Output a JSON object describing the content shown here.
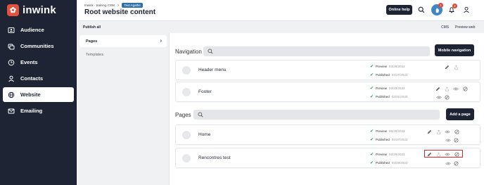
{
  "brand": {
    "name": "inwink"
  },
  "sidebar": {
    "items": [
      {
        "label": "Audience",
        "icon": "id-card-icon"
      },
      {
        "label": "Communities",
        "icon": "communities-icon"
      },
      {
        "label": "Events",
        "icon": "calendar-icon"
      },
      {
        "label": "Contacts",
        "icon": "person-icon"
      },
      {
        "label": "Website",
        "icon": "globe-icon",
        "active": true
      },
      {
        "label": "Emailing",
        "icon": "mail-icon"
      }
    ]
  },
  "header": {
    "breadcrumb": [
      "Inwink - training CSM",
      ">"
    ],
    "env_badge": "Test Agathe",
    "title": "Root website content",
    "online_help": "Online help",
    "notifications": {
      "apps_count": "1",
      "bell_count": "2"
    }
  },
  "subbar": {
    "publish_all": "Publish all",
    "cms": "CMS",
    "preview_web": "Preview web"
  },
  "left_panel": {
    "items": [
      {
        "label": "Pages",
        "active": true
      },
      {
        "label": "Templates",
        "active": false
      }
    ]
  },
  "navigation": {
    "title": "Navigation",
    "button": "Mobile navigation",
    "items": [
      {
        "name": "Header menu",
        "preview_label": "Preview",
        "preview_date": "03/29/2022",
        "published_label": "Published",
        "published_date": "04/27/2022"
      },
      {
        "name": "Footer",
        "preview_label": "Preview",
        "preview_date": "03/29/2022",
        "published_label": "Published",
        "published_date": "03/31/2020"
      }
    ]
  },
  "pages": {
    "title": "Pages",
    "button": "Add a page",
    "items": [
      {
        "name": "Home",
        "preview_label": "Preview",
        "preview_date": "06/30/2022",
        "published_label": "Published",
        "published_date": "04/27/2022"
      },
      {
        "name": "Rencontres test",
        "preview_label": "Preview",
        "preview_date": "03/29/2022",
        "published_label": "Published",
        "published_date": "03/29/2022"
      }
    ]
  },
  "colors": {
    "sidebar_bg": "#1e2433",
    "accent_red": "#d8262a",
    "check_green": "#2e9a4a",
    "brand": "#e1533f"
  }
}
